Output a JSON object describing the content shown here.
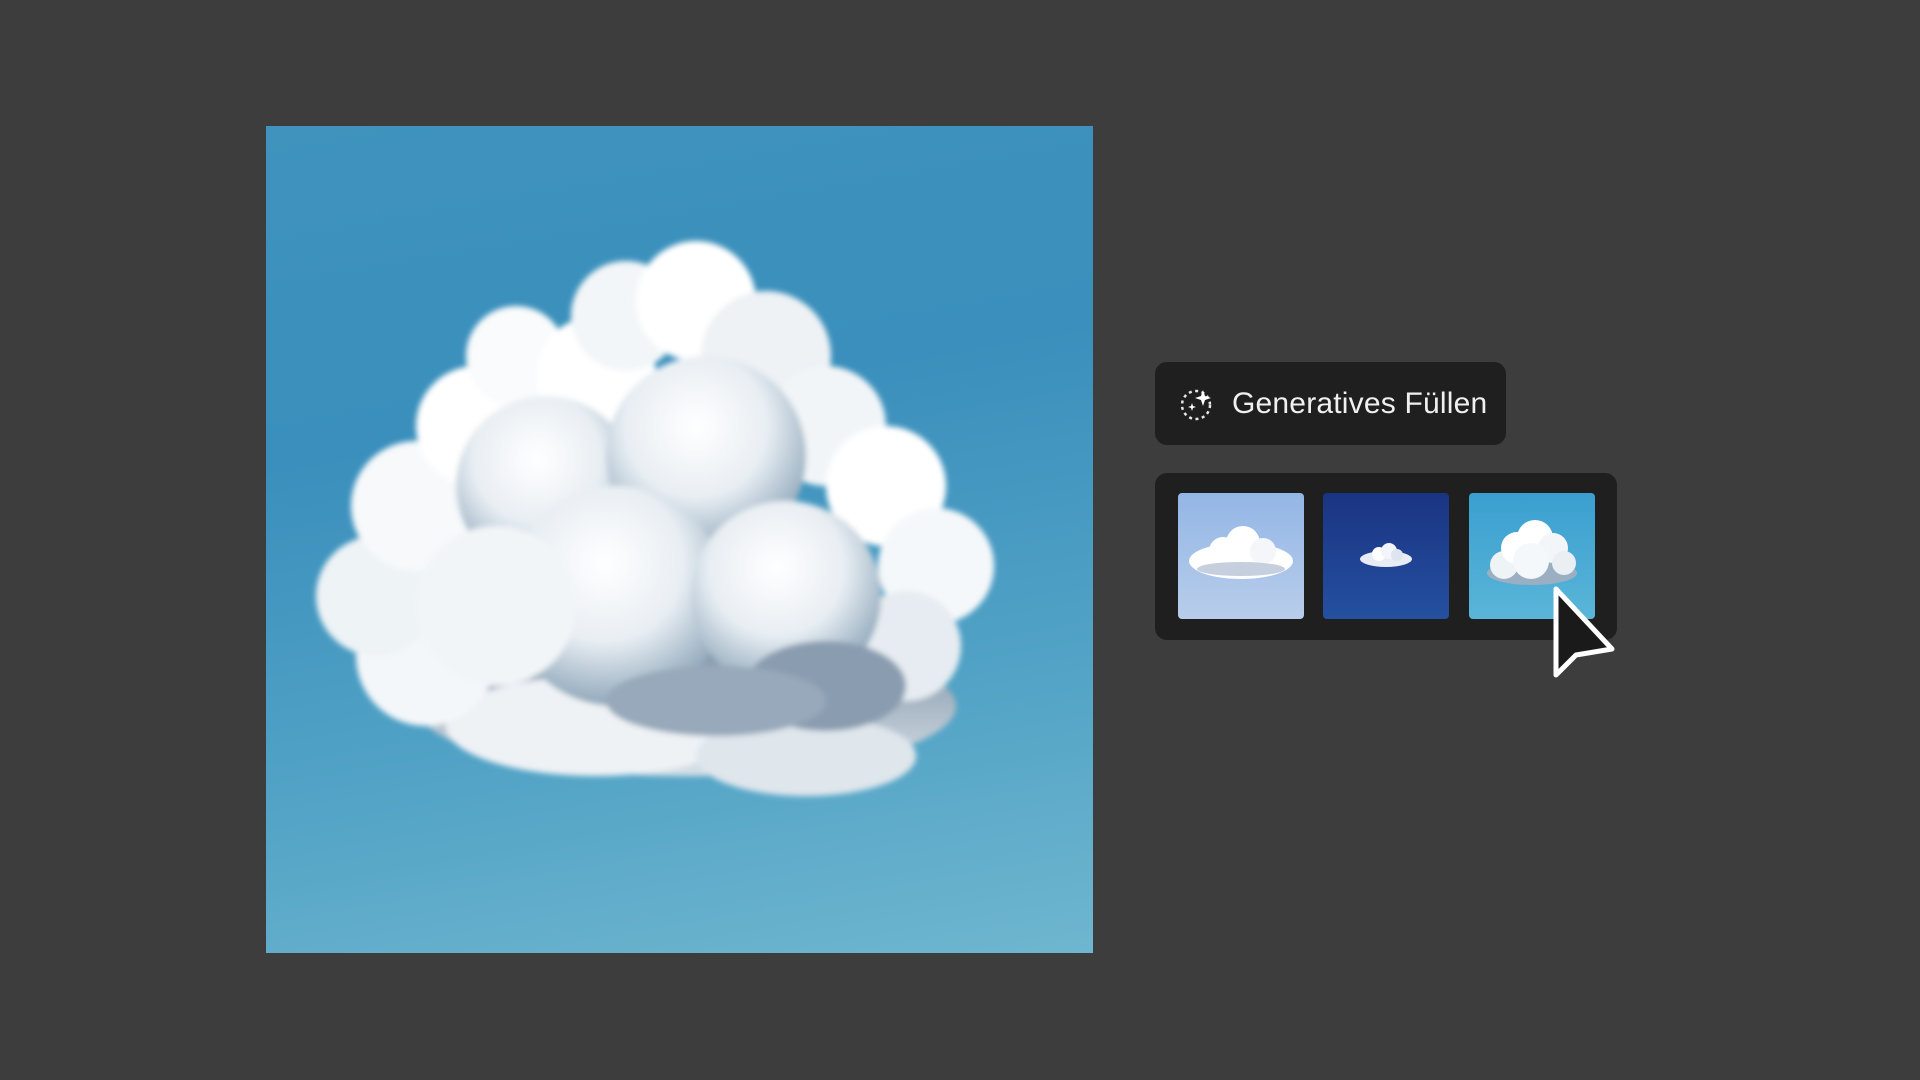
{
  "canvas": {
    "image_subject": "cumulus cloud on blue sky"
  },
  "generative_fill": {
    "label": "Generatives Füllen",
    "icon": "generative-fill-sparkle-icon"
  },
  "variations": [
    {
      "name": "variation-1",
      "sky": "#9fbde8",
      "cloud": "#ffffff"
    },
    {
      "name": "variation-2",
      "sky": "#1d3f8c",
      "cloud": "#e8edf5"
    },
    {
      "name": "variation-3",
      "sky": "#47a9d3",
      "cloud": "#ffffff"
    }
  ],
  "colors": {
    "background": "#3d3d3d",
    "panel": "#1f1f1f",
    "text": "#f0f0f0"
  }
}
